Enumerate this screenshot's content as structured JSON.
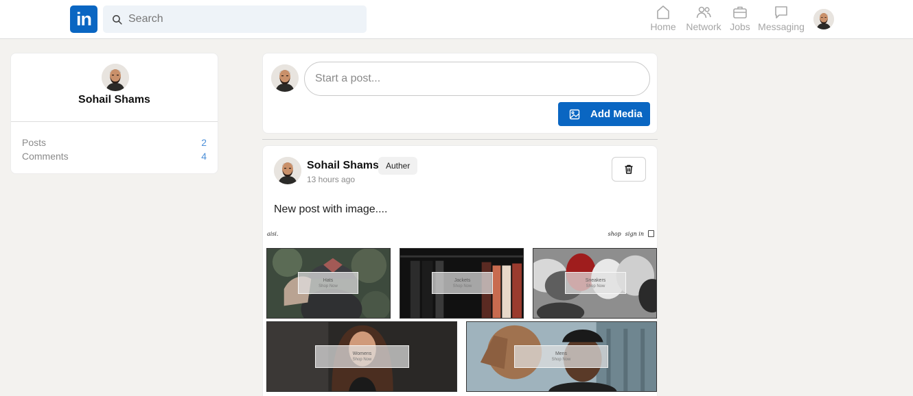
{
  "header": {
    "logo_text": "in",
    "search_placeholder": "Search",
    "nav": [
      {
        "label": "Home",
        "icon": "home-icon"
      },
      {
        "label": "Network",
        "icon": "network-icon"
      },
      {
        "label": "Jobs",
        "icon": "briefcase-icon"
      },
      {
        "label": "Messaging",
        "icon": "message-icon"
      }
    ]
  },
  "profile": {
    "name": "Sohail Shams",
    "stats": [
      {
        "label": "Posts",
        "value": "2"
      },
      {
        "label": "Comments",
        "value": "4"
      }
    ]
  },
  "composer": {
    "placeholder": "Start a post...",
    "add_media_label": "Add Media"
  },
  "post": {
    "author": "Sohail Shams",
    "badge": "Auther",
    "time": "13 hours ago",
    "text": "New post with image....",
    "image": {
      "brand": "aisi.",
      "nav": [
        "shop",
        "sign in"
      ],
      "tiles": [
        {
          "title": "Hats",
          "cta": "Shop Now"
        },
        {
          "title": "Jackets",
          "cta": "Shop Now"
        },
        {
          "title": "Sneakers",
          "cta": "Shop Now"
        },
        {
          "title": "Womens",
          "cta": "Shop Now"
        },
        {
          "title": "Mens",
          "cta": "Shop Now"
        }
      ]
    }
  },
  "colors": {
    "brand": "#0a66c2",
    "background": "#f3f2ef",
    "stat_value": "#4b8fd8"
  }
}
